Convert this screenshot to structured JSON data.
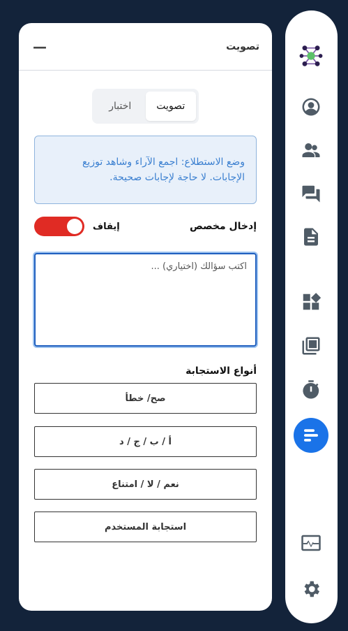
{
  "panel": {
    "title": "تصويت",
    "minimize_label": "—"
  },
  "tabs": [
    {
      "label": "تصويت",
      "active": true
    },
    {
      "label": "اختبار",
      "active": false
    }
  ],
  "info": {
    "text": "وضع الاستطلاع: اجمع الآراء وشاهد توزيع الإجابات. لا حاجة لإجابات صحيحة."
  },
  "custom_entry": {
    "label": "إدخال مخصص",
    "state_label": "إيقاف",
    "toggle_color": "#e02b24"
  },
  "question": {
    "placeholder": "اكتب سؤالك (اختياري) ..."
  },
  "response_types": {
    "title": "أنواع الاستجابة",
    "options": [
      "صح/ خطأ",
      "أ / ب / ج / د",
      "نعم / لا / امتناع",
      "استجابة المستخدم"
    ]
  },
  "sidebar": {
    "items": [
      {
        "icon": "logo-icon"
      },
      {
        "icon": "account-circle-icon"
      },
      {
        "icon": "people-icon"
      },
      {
        "icon": "chat-icon"
      },
      {
        "icon": "document-icon"
      },
      {
        "icon": "widgets-icon"
      },
      {
        "icon": "library-icon"
      },
      {
        "icon": "timer-icon"
      },
      {
        "icon": "poll-icon",
        "active": true
      },
      {
        "icon": "activity-monitor-icon"
      },
      {
        "icon": "settings-icon"
      }
    ],
    "active_color": "#1a73e8"
  }
}
